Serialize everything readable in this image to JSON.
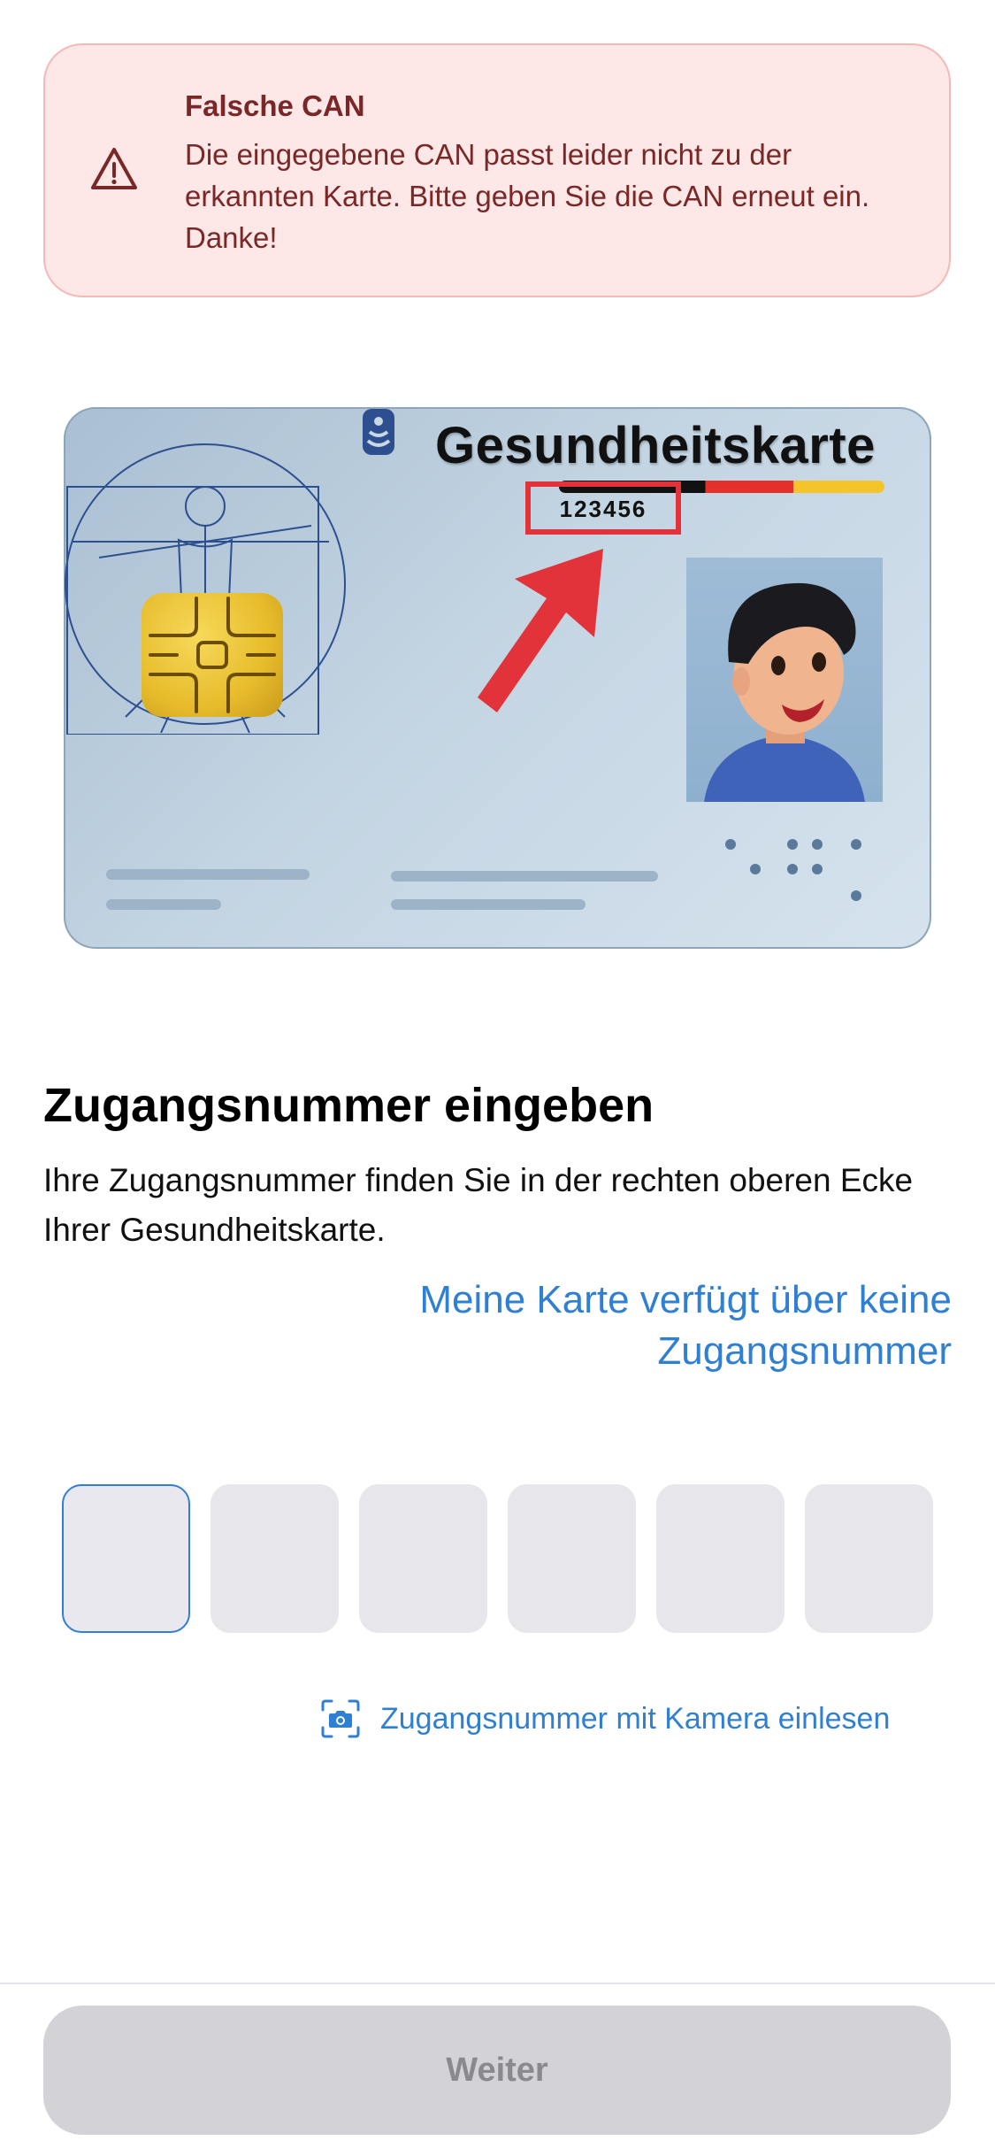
{
  "error": {
    "title": "Falsche CAN",
    "text": "Die eingegebene CAN passt leider nicht zu der erkannten Karte. Bitte geben Sie die CAN erneut ein. Danke!",
    "icon": "warning-triangle-icon"
  },
  "card": {
    "title": "Gesundheitskarte",
    "can_number": "123456"
  },
  "main": {
    "title": "Zugangsnummer eingeben",
    "description": "Ihre Zugangsnummer finden Sie in der rechten oberen Ecke Ihrer Gesundheitskarte.",
    "no_can_link": "Meine Karte verfügt über keine Zugangsnummer"
  },
  "pin": {
    "length": 6,
    "values": [
      "",
      "",
      "",
      "",
      "",
      ""
    ],
    "active_index": 0
  },
  "camera": {
    "label": "Zugangsnummer mit Kamera einlesen",
    "icon": "camera-icon"
  },
  "footer": {
    "continue_label": "Weiter",
    "continue_enabled": false
  },
  "colors": {
    "accent": "#2f7fd2",
    "error_bg": "#fde7e7",
    "error_text": "#7a2727",
    "button_disabled": "#d2d2d7"
  }
}
